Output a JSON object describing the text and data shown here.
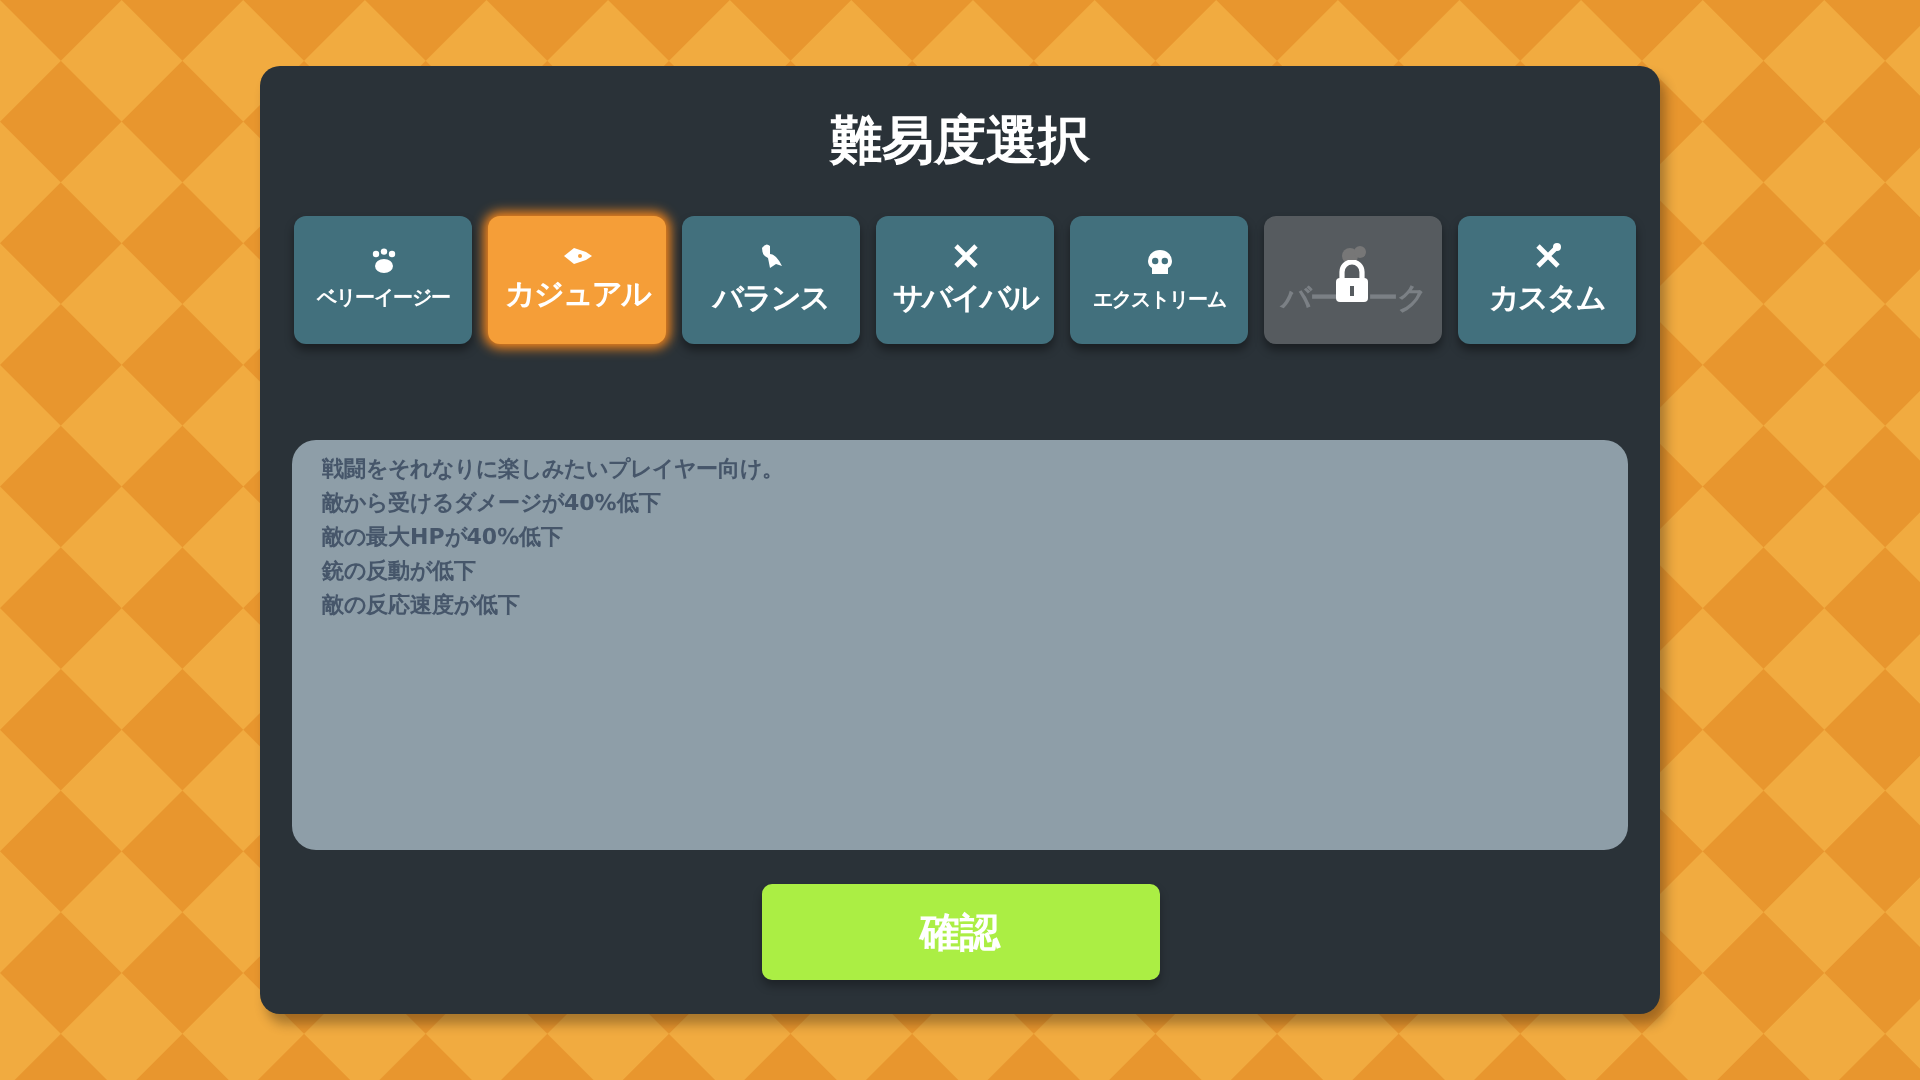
{
  "title": "難易度選択",
  "tabs": [
    {
      "label": "ベリーイージー",
      "selected": false,
      "locked": false,
      "small": true
    },
    {
      "label": "カジュアル",
      "selected": true,
      "locked": false,
      "small": false
    },
    {
      "label": "バランス",
      "selected": false,
      "locked": false,
      "small": false
    },
    {
      "label": "サバイバル",
      "selected": false,
      "locked": false,
      "small": false
    },
    {
      "label": "エクストリーム",
      "selected": false,
      "locked": false,
      "small": true
    },
    {
      "label": "バー　ーク",
      "selected": false,
      "locked": true,
      "small": false
    },
    {
      "label": "カスタム",
      "selected": false,
      "locked": false,
      "small": false
    }
  ],
  "description": [
    "戦闘をそれなりに楽しみたいプレイヤー向け。",
    "敵から受けるダメージが40%低下",
    "敵の最大HPが40%低下",
    "銃の反動が低下",
    "敵の反応速度が低下"
  ],
  "confirm_button": "確認"
}
